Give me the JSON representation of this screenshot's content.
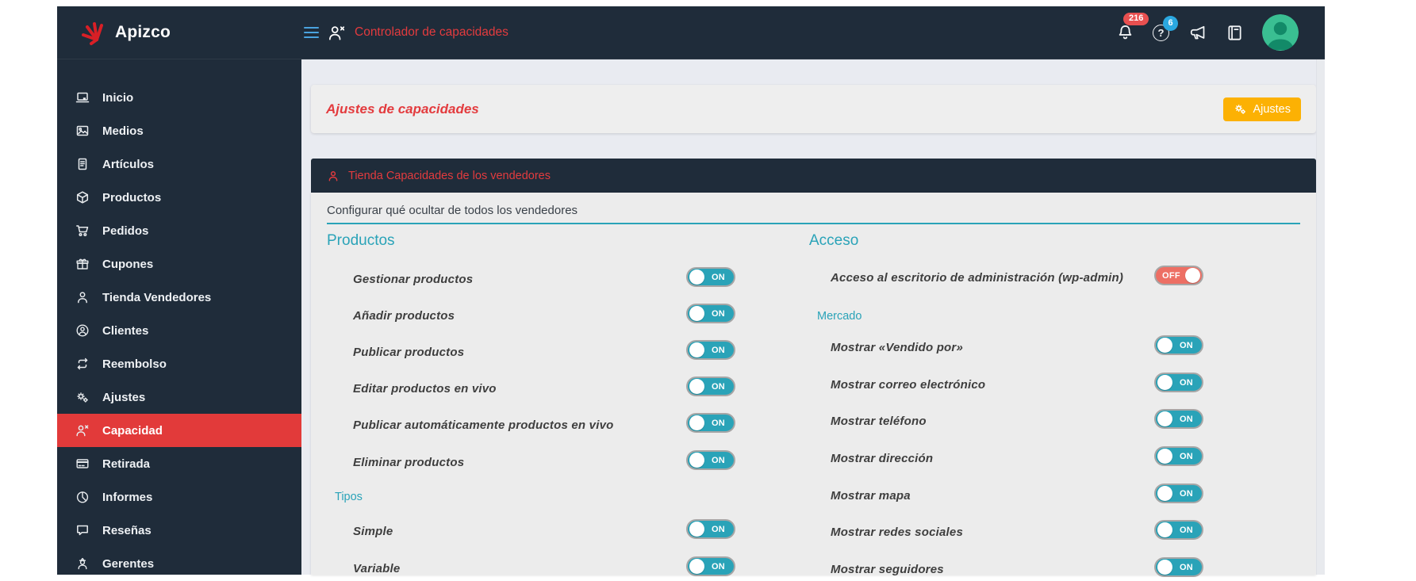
{
  "brand": {
    "name": "Apizco",
    "logo_icon": "spark-logo-icon"
  },
  "topbar": {
    "title": "Controlador de capacidades",
    "menu_icon": "hamburger-icon",
    "title_icon": "person-x-icon",
    "notifications": {
      "icon": "bell-icon",
      "count": "216"
    },
    "help": {
      "icon": "question-circle-icon",
      "glyph": "?",
      "count": "6"
    },
    "announce_icon": "megaphone-icon",
    "docs_icon": "book-icon",
    "avatar_icon": "user-avatar"
  },
  "sidebar": {
    "items": [
      {
        "label": "Inicio",
        "icon": "laptop-icon"
      },
      {
        "label": "Medios",
        "icon": "image-icon"
      },
      {
        "label": "Artículos",
        "icon": "document-icon"
      },
      {
        "label": "Productos",
        "icon": "cube-icon"
      },
      {
        "label": "Pedidos",
        "icon": "cart-icon"
      },
      {
        "label": "Cupones",
        "icon": "gift-icon"
      },
      {
        "label": "Tienda Vendedores",
        "icon": "person-icon"
      },
      {
        "label": "Clientes",
        "icon": "person-circle-icon"
      },
      {
        "label": "Reembolso",
        "icon": "repeat-icon"
      },
      {
        "label": "Ajustes",
        "icon": "gears-icon"
      },
      {
        "label": "Capacidad",
        "icon": "person-x-icon",
        "active": true
      },
      {
        "label": "Retirada",
        "icon": "credit-card-icon"
      },
      {
        "label": "Informes",
        "icon": "pie-chart-icon"
      },
      {
        "label": "Reseñas",
        "icon": "chat-bubble-icon"
      },
      {
        "label": "Gerentes",
        "icon": "manager-icon"
      }
    ]
  },
  "content": {
    "page_header": {
      "title": "Ajustes de capacidades",
      "button": {
        "label": "Ajustes",
        "icon": "gears-icon"
      }
    },
    "section": {
      "icon": "person-icon",
      "title": "Tienda Capacidades de los vendedores"
    },
    "description": "Configurar qué ocultar de todos los vendedores",
    "columns": {
      "left": {
        "heading": "Productos",
        "rows": [
          {
            "label": "Gestionar productos",
            "state": "on",
            "state_label": "ON"
          },
          {
            "label": "Añadir productos",
            "state": "on",
            "state_label": "ON"
          },
          {
            "label": "Publicar productos",
            "state": "on",
            "state_label": "ON"
          },
          {
            "label": "Editar productos en vivo",
            "state": "on",
            "state_label": "ON"
          },
          {
            "label": "Publicar automáticamente productos en vivo",
            "state": "on",
            "state_label": "ON"
          },
          {
            "label": "Eliminar productos",
            "state": "on",
            "state_label": "ON"
          }
        ],
        "subheading": "Tipos",
        "subrows": [
          {
            "label": "Simple",
            "state": "on",
            "state_label": "ON"
          },
          {
            "label": "Variable",
            "state": "on",
            "state_label": "ON"
          }
        ]
      },
      "right": {
        "heading": "Acceso",
        "rows": [
          {
            "label": "Acceso al escritorio de administración (wp-admin)",
            "state": "off",
            "state_label": "OFF"
          }
        ],
        "subheading": "Mercado",
        "subrows": [
          {
            "label": "Mostrar «Vendido por»",
            "state": "on",
            "state_label": "ON"
          },
          {
            "label": "Mostrar correo electrónico",
            "state": "on",
            "state_label": "ON"
          },
          {
            "label": "Mostrar teléfono",
            "state": "on",
            "state_label": "ON"
          },
          {
            "label": "Mostrar dirección",
            "state": "on",
            "state_label": "ON"
          },
          {
            "label": "Mostrar mapa",
            "state": "on",
            "state_label": "ON"
          },
          {
            "label": "Mostrar redes sociales",
            "state": "on",
            "state_label": "ON"
          },
          {
            "label": "Mostrar seguidores",
            "state": "on",
            "state_label": "ON"
          }
        ]
      }
    }
  },
  "colors": {
    "topbar_bg": "#1f2c3a",
    "accent_red": "#e33b3e",
    "active_item_bg": "#e23a3a",
    "teal": "#2aa3b8",
    "toggle_on": "#2aa3b8",
    "toggle_off": "#ed6f64",
    "button_orange": "#fcb103",
    "badge_red": "#e85050",
    "badge_blue": "#2ba8e0",
    "avatar_green": "#3abf92",
    "logo_red": "#d81f26",
    "hamburger_blue": "#4aa3df"
  }
}
